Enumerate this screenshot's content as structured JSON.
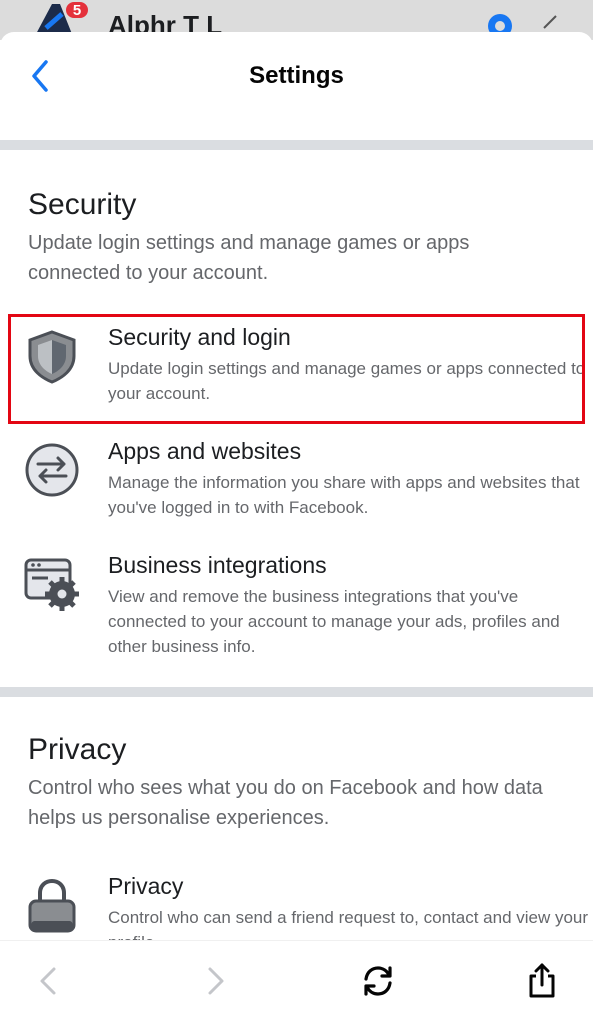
{
  "background_app": {
    "badge_count": "5",
    "profile_name": "Alphr T L"
  },
  "header": {
    "title": "Settings"
  },
  "security": {
    "title": "Security",
    "description": "Update login settings and manage games or apps connected to your account.",
    "items": [
      {
        "label": "Security and login",
        "description": "Update login settings and manage games or apps connected to your account.",
        "icon": "shield-icon",
        "highlighted": true
      },
      {
        "label": "Apps and websites",
        "description": "Manage the information you share with apps and websites that you've logged in to with Facebook.",
        "icon": "swap-arrows-icon"
      },
      {
        "label": "Business integrations",
        "description": "View and remove the business integrations that you've connected to your account to manage your ads, profiles and other business info.",
        "icon": "browser-gear-icon"
      }
    ]
  },
  "privacy": {
    "title": "Privacy",
    "description": "Control who sees what you do on Facebook and how data helps us personalise experiences.",
    "items": [
      {
        "label": "Privacy",
        "description": "Control who can send a friend request to, contact and view your profile.",
        "icon": "lock-icon"
      }
    ]
  },
  "colors": {
    "accent": "#1877f2",
    "highlight": "#e30613",
    "divider": "#dadde1",
    "secondary_text": "#65676b"
  }
}
